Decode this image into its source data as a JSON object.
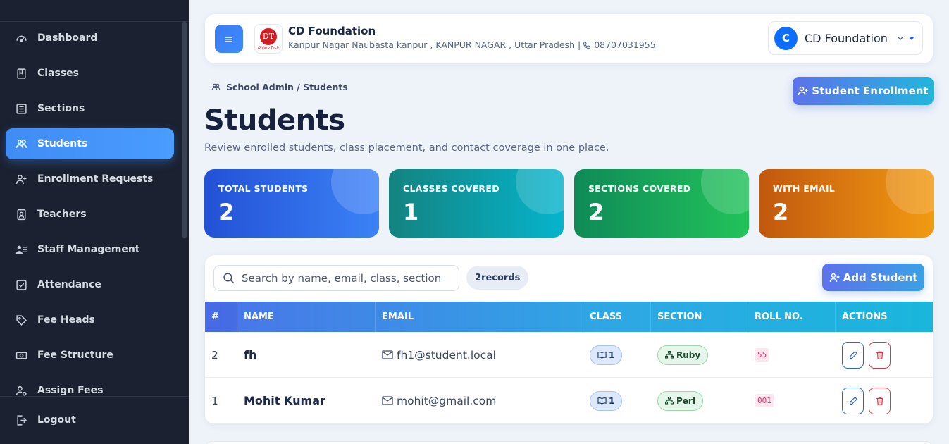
{
  "sidebar": {
    "items": [
      {
        "label": "Dashboard",
        "icon": "gauge-icon"
      },
      {
        "label": "Classes",
        "icon": "book-icon"
      },
      {
        "label": "Sections",
        "icon": "list-icon"
      },
      {
        "label": "Students",
        "icon": "people-icon"
      },
      {
        "label": "Enrollment Requests",
        "icon": "person-add-icon"
      },
      {
        "label": "Teachers",
        "icon": "badge-icon"
      },
      {
        "label": "Staff Management",
        "icon": "staff-icon"
      },
      {
        "label": "Attendance",
        "icon": "check-square-icon"
      },
      {
        "label": "Fee Heads",
        "icon": "tag-icon"
      },
      {
        "label": "Fee Structure",
        "icon": "cash-icon"
      },
      {
        "label": "Assign Fees",
        "icon": "person-gear-icon"
      }
    ],
    "active": "Students",
    "logout_label": "Logout"
  },
  "header": {
    "menu_icon": "hamburger-icon",
    "org_name": "CD Foundation",
    "org_address": "Kanpur Nagar Naubasta kanpur , KANPUR NAGAR , Uttar Pradesh |",
    "org_phone": "08707031955",
    "account_initial": "C",
    "account_name": "CD Foundation",
    "logo_text": "Dhjaro Technology"
  },
  "breadcrumb": "School Admin / Students",
  "enroll_button": "Student Enrollment",
  "page": {
    "title": "Students",
    "subtitle": "Review enrolled students, class placement, and contact coverage in one place."
  },
  "stats": [
    {
      "label": "TOTAL STUDENTS",
      "value": "2"
    },
    {
      "label": "CLASSES COVERED",
      "value": "1"
    },
    {
      "label": "SECTIONS COVERED",
      "value": "2"
    },
    {
      "label": "WITH EMAIL",
      "value": "2"
    }
  ],
  "search": {
    "placeholder": "Search by name, email, class, section"
  },
  "records_badge": "2records",
  "add_button": "Add Student",
  "table": {
    "columns": [
      "#",
      "NAME",
      "EMAIL",
      "CLASS",
      "SECTION",
      "ROLL NO.",
      "ACTIONS"
    ],
    "rows": [
      {
        "num": "2",
        "name": "fh",
        "email": "fh1@student.local",
        "class": "1",
        "section": "Ruby",
        "roll": "55"
      },
      {
        "num": "1",
        "name": "Mohit Kumar",
        "email": "mohit@gmail.com",
        "class": "1",
        "section": "Perl",
        "roll": "001"
      }
    ]
  },
  "colors": {
    "sidebar_bg": "#1b2130",
    "accent": "#3f8cf5",
    "page_bg": "#eef2f9"
  }
}
